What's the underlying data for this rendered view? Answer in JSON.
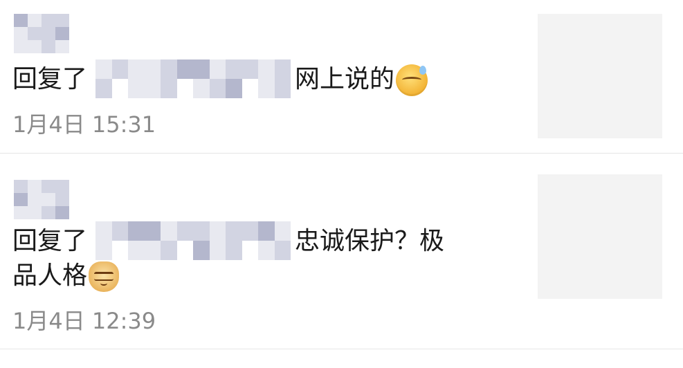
{
  "notifications": [
    {
      "reply_prefix": "回复了",
      "message": "网上说的",
      "message_line2": "",
      "emoji": "sweat-smile-emoji",
      "timestamp": "1月4日 15:31"
    },
    {
      "reply_prefix": "回复了",
      "message": "忠诚保护？极",
      "message_line2": "品人格",
      "emoji": "doge-emoji",
      "timestamp": "1月4日 12:39"
    }
  ],
  "colors": {
    "background": "#ffffff",
    "text_primary": "#1a1a1a",
    "text_secondary": "#8a8a8a",
    "divider": "#e6e6e6",
    "thumbnail_placeholder": "#f3f3f3",
    "mosaic_light": "#e8e9f0",
    "mosaic_mid": "#d2d4e2",
    "mosaic_dark": "#b4b7cd"
  }
}
